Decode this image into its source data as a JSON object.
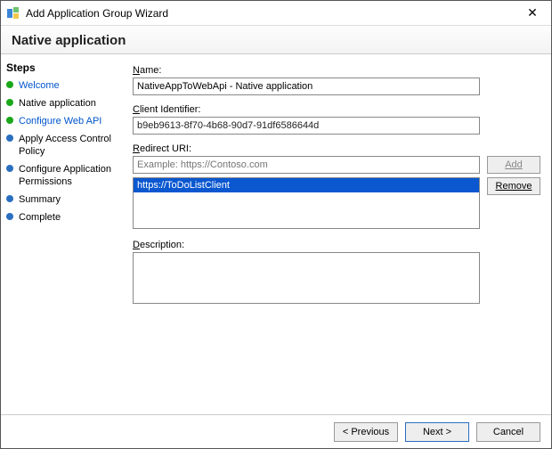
{
  "window": {
    "title": "Add Application Group Wizard",
    "close_glyph": "✕"
  },
  "header": "Native application",
  "sidebar": {
    "title": "Steps",
    "items": [
      {
        "label": "Welcome",
        "state": "done",
        "style": "link"
      },
      {
        "label": "Native application",
        "state": "done",
        "style": "plain"
      },
      {
        "label": "Configure Web API",
        "state": "done",
        "style": "link"
      },
      {
        "label": "Apply Access Control Policy",
        "state": "todo",
        "style": "plain"
      },
      {
        "label": "Configure Application Permissions",
        "state": "todo",
        "style": "plain"
      },
      {
        "label": "Summary",
        "state": "todo",
        "style": "plain"
      },
      {
        "label": "Complete",
        "state": "todo",
        "style": "plain"
      }
    ]
  },
  "form": {
    "name_label": "Name:",
    "name_value": "NativeAppToWebApi - Native application",
    "client_id_label": "Client Identifier:",
    "client_id_value": "b9eb9613-8f70-4b68-90d7-91df6586644d",
    "redirect_label": "Redirect URI:",
    "redirect_placeholder": "Example: https://Contoso.com",
    "redirect_add_label": "Add",
    "redirect_items": [
      "https://ToDoListClient"
    ],
    "redirect_remove_label": "Remove",
    "description_label": "Description:",
    "description_value": ""
  },
  "footer": {
    "previous": "< Previous",
    "next": "Next >",
    "cancel": "Cancel"
  }
}
